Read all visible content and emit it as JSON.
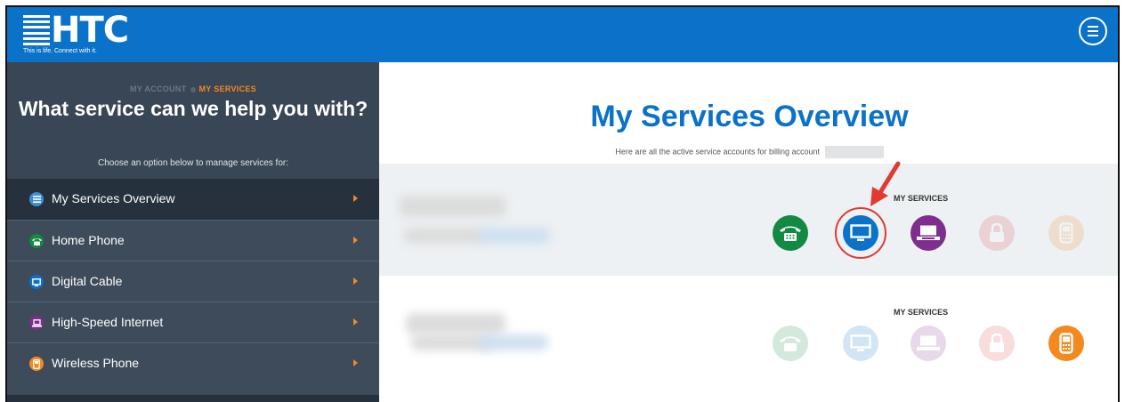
{
  "header": {
    "logo_text": "HTC",
    "tagline": "This is life. Connect with it.",
    "menu_icon": "hamburger-menu-icon"
  },
  "sidebar": {
    "breadcrumb": [
      "MY ACCOUNT",
      "MY SERVICES"
    ],
    "title": "What service can we help you with?",
    "subtitle": "Choose an option below to manage services for:",
    "items": [
      {
        "label": "My Services Overview",
        "icon": "list-icon",
        "color": "#3a8fd9",
        "active": true
      },
      {
        "label": "Home Phone",
        "icon": "phone-icon",
        "color": "#138a44"
      },
      {
        "label": "Digital Cable",
        "icon": "tv-icon",
        "color": "#0a72c9"
      },
      {
        "label": "High-Speed Internet",
        "icon": "laptop-icon",
        "color": "#7d2e8f"
      },
      {
        "label": "Wireless Phone",
        "icon": "mobile-icon",
        "color": "#f4891f"
      }
    ]
  },
  "main": {
    "title": "My Services Overview",
    "subtitle": "Here are all the active service accounts for billing account",
    "accounts": [
      {
        "services_label": "MY SERVICES",
        "services": [
          {
            "icon": "phone-icon",
            "color": "#138a44",
            "active": true
          },
          {
            "icon": "tv-icon",
            "color": "#0a72c9",
            "active": true,
            "highlighted": true
          },
          {
            "icon": "laptop-icon",
            "color": "#7d2e8f",
            "active": true
          },
          {
            "icon": "lock-icon",
            "color": "#e0464b",
            "active": false
          },
          {
            "icon": "mobile-icon",
            "color": "#f4891f",
            "active": false
          }
        ]
      },
      {
        "services_label": "MY SERVICES",
        "services": [
          {
            "icon": "phone-icon",
            "color": "#138a44",
            "active": false
          },
          {
            "icon": "tv-icon",
            "color": "#0a72c9",
            "active": false
          },
          {
            "icon": "laptop-icon",
            "color": "#7d2e8f",
            "active": false
          },
          {
            "icon": "lock-icon",
            "color": "#e0464b",
            "active": false
          },
          {
            "icon": "mobile-icon",
            "color": "#f4891f",
            "active": true
          }
        ]
      }
    ]
  },
  "colors": {
    "brand_blue": "#0a72c9",
    "sidebar_bg": "#3d4b5a",
    "accent_orange": "#f4891f",
    "highlight_red": "#e03a31"
  }
}
